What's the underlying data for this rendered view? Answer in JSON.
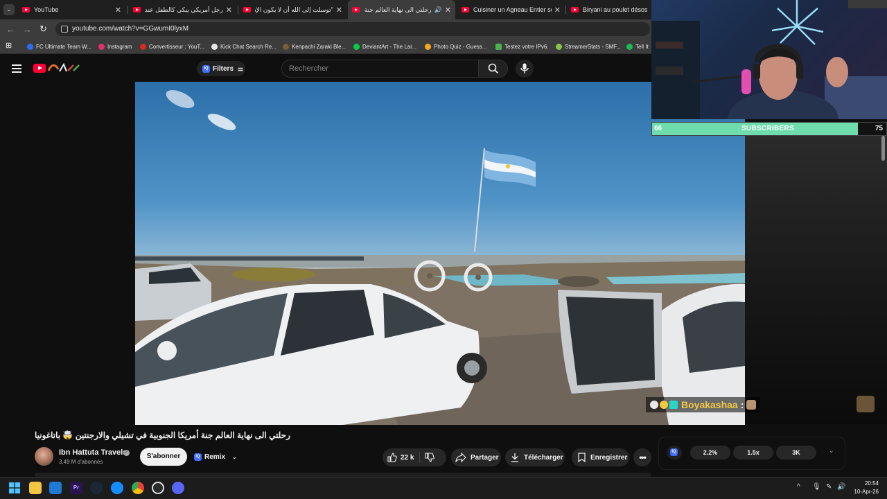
{
  "browser": {
    "tabs": [
      {
        "title": "YouTube",
        "active": false
      },
      {
        "title": "رجل أمريكي يبكي كالطفل عندما...",
        "active": false
      },
      {
        "title": "\"توسلت إلى الله أن لا يكون الإسلا...",
        "active": false
      },
      {
        "title": "رحلتي الى نهاية العالم جنة أم...",
        "active": true
      },
      {
        "title": "Cuisiner un Agneau Entier sous...",
        "active": false
      },
      {
        "title": "Biryani au poulet désossé sp...",
        "active": false
      }
    ],
    "url": "youtube.com/watch?v=GGwumI0lyxM",
    "bookmarks": [
      {
        "label": "FC Ultimate Team W...",
        "color": "#2f6df5"
      },
      {
        "label": "Instagram",
        "color": "#e1306c"
      },
      {
        "label": "Convertisseur : YouT...",
        "color": "#d62828"
      },
      {
        "label": "Kick Chat Search Re...",
        "color": "#e8e8e8"
      },
      {
        "label": "Kenpachi Zaraki Ble...",
        "color": "#7a5c3a"
      },
      {
        "label": "DeviantArt - The Lar...",
        "color": "#05cc47"
      },
      {
        "label": "Photo Quiz - Guess...",
        "color": "#f5a623"
      },
      {
        "label": "Testez votre IPv6.",
        "color": "#4caf50"
      },
      {
        "label": "StreamerStats - SMF...",
        "color": "#8bc34a"
      },
      {
        "label": "Tell It",
        "color": "#1db954"
      }
    ]
  },
  "youtube": {
    "filters_label": "Filters",
    "search_placeholder": "Rechercher",
    "video": {
      "title": "رحلتي الى نهاية العالم جنة أمريكا الجنوبية في تشيلي والارجنتين 🤯 باتاغونيا",
      "channel": "Ibn Hattuta Travels",
      "subscribers": "3,49 M d'abonnés",
      "subscribe_label": "S'abonner",
      "remix_label": "Remix",
      "likes": "22 k",
      "share_label": "Partager",
      "download_label": "Télécharger",
      "save_label": "Enregistrer"
    },
    "iq_widget": {
      "stats": [
        "2.2%",
        "1.5x",
        "3K"
      ]
    }
  },
  "stream_overlay": {
    "subscribers_label": "SUBSCRIBERS",
    "sub_current": "66",
    "sub_goal": "75",
    "sub_progress": 0.88,
    "chat_user": "Boyakashaa",
    "chat_sep": ":"
  },
  "taskbar": {
    "time": "20:54",
    "date": "10-Apr-26"
  }
}
